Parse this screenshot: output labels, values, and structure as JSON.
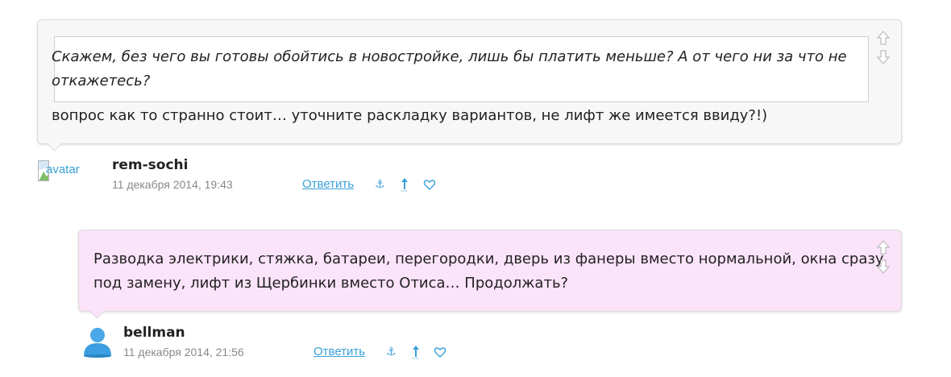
{
  "comment1": {
    "quote": "Скажем, без чего вы готовы обойтись в новостройке, лишь бы платить меньше? А от чего ни за что не откажетесь?",
    "text": "вопрос как то странно стоит… уточните раскладку вариантов, не лифт же имеется ввиду?!)",
    "author": "rem-sochi",
    "avatar_alt": "avatar",
    "date": "11 декабря 2014, 19:43",
    "reply_label": "Ответить",
    "background": "#f7f7f7"
  },
  "comment2": {
    "text": "Разводка электрики, стяжка, батареи, перегородки, дверь из фанеры вместо нормальной, окна сразу под замену, лифт из Щербинки вместо Отиса… Продолжать?",
    "author": "bellman",
    "date": "11 декабря 2014, 21:56",
    "reply_label": "Ответить",
    "background": "#fbe3f9"
  },
  "icons": {
    "anchor": "anchor-icon",
    "parent": "arrow-up-icon",
    "like": "heart-icon",
    "vote_up": "vote-up-arrow-icon",
    "vote_down": "vote-down-arrow-icon",
    "accent": "#3aa0d8"
  }
}
